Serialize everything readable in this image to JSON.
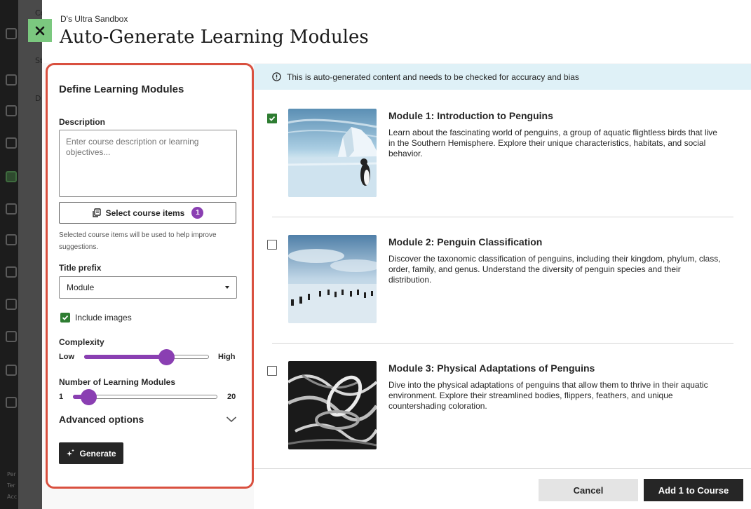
{
  "background": {
    "col_texts": [
      "Co",
      "St",
      "D"
    ],
    "footer_texts": [
      "Per",
      "Ter",
      "Acc"
    ]
  },
  "header": {
    "subtitle": "D's Ultra Sandbox",
    "title": "Auto-Generate Learning Modules"
  },
  "form": {
    "title": "Define Learning Modules",
    "description_label": "Description",
    "description_placeholder": "Enter course description or learning objectives...",
    "select_items_label": "Select course items",
    "select_items_count": "1",
    "select_items_hint": "Selected course items will be used to help improve suggestions.",
    "title_prefix_label": "Title prefix",
    "title_prefix_value": "Module",
    "include_images_label": "Include images",
    "include_images_checked": true,
    "complexity_label": "Complexity",
    "complexity_low": "Low",
    "complexity_high": "High",
    "complexity_level": 0.66,
    "num_modules_label": "Number of Learning Modules",
    "num_modules_min": "1",
    "num_modules_max": "20",
    "num_modules_value": 3,
    "advanced_label": "Advanced options",
    "generate_label": "Generate"
  },
  "notice": {
    "text": "This is auto-generated content and needs to be checked for accuracy and bias"
  },
  "modules": [
    {
      "title": "Module 1: Introduction to Penguins",
      "description": "Learn about the fascinating world of penguins, a group of aquatic flightless birds that live in the Southern Hemisphere. Explore their unique characteristics, habitats, and social behavior.",
      "checked": true
    },
    {
      "title": "Module 2: Penguin Classification",
      "description": "Discover the taxonomic classification of penguins, including their kingdom, phylum, class, order, family, and genus. Understand the diversity of penguin species and their distribution.",
      "checked": false
    },
    {
      "title": "Module 3: Physical Adaptations of Penguins",
      "description": "Dive into the physical adaptations of penguins that allow them to thrive in their aquatic environment. Explore their streamlined bodies, flippers, feathers, and unique countershading coloration.",
      "checked": false
    }
  ],
  "footer": {
    "cancel_label": "Cancel",
    "add_label": "Add 1 to Course"
  },
  "colors": {
    "accent_purple": "#8a3fb2",
    "check_green": "#2e7d32",
    "highlight_red": "#d9503f",
    "close_green": "#7bc87f",
    "notice_bg": "#dff1f7"
  }
}
